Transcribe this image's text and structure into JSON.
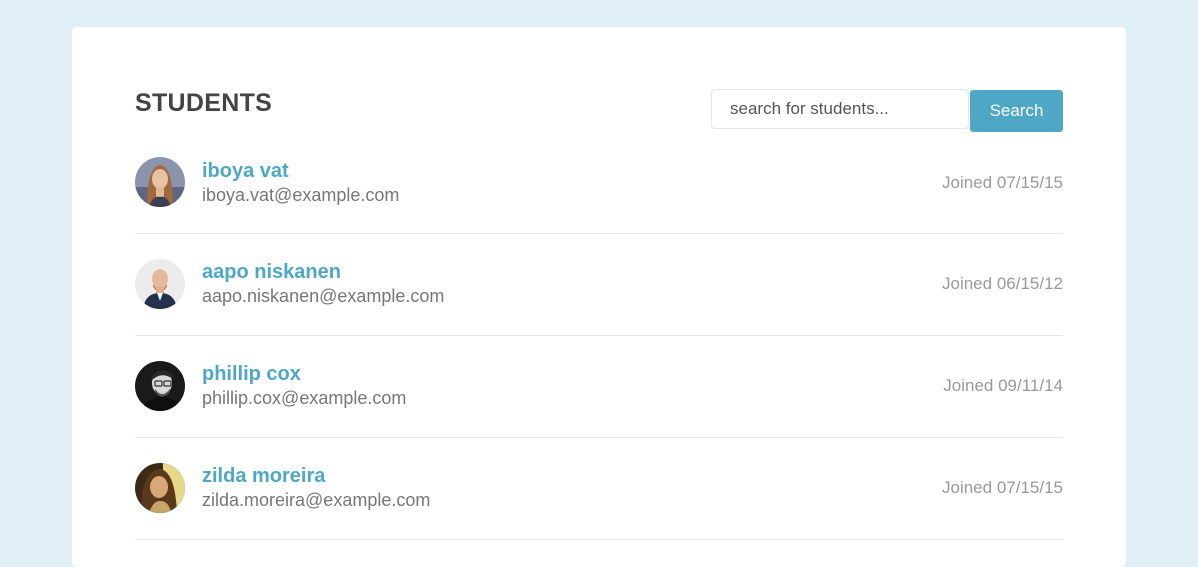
{
  "header": {
    "title": "STUDENTS"
  },
  "search": {
    "placeholder": "search for students...",
    "value": "",
    "button_label": "Search"
  },
  "students": [
    {
      "name": "iboya vat",
      "email": "iboya.vat@example.com",
      "joined": "Joined 07/15/15"
    },
    {
      "name": "aapo niskanen",
      "email": "aapo.niskanen@example.com",
      "joined": "Joined 06/15/12"
    },
    {
      "name": "phillip cox",
      "email": "phillip.cox@example.com",
      "joined": "Joined 09/11/14"
    },
    {
      "name": "zilda moreira",
      "email": "zilda.moreira@example.com",
      "joined": "Joined 07/15/15"
    }
  ],
  "colors": {
    "page_background": "#e1f0f6",
    "accent": "#4fa7c6",
    "title": "#444444",
    "muted": "#999999"
  }
}
